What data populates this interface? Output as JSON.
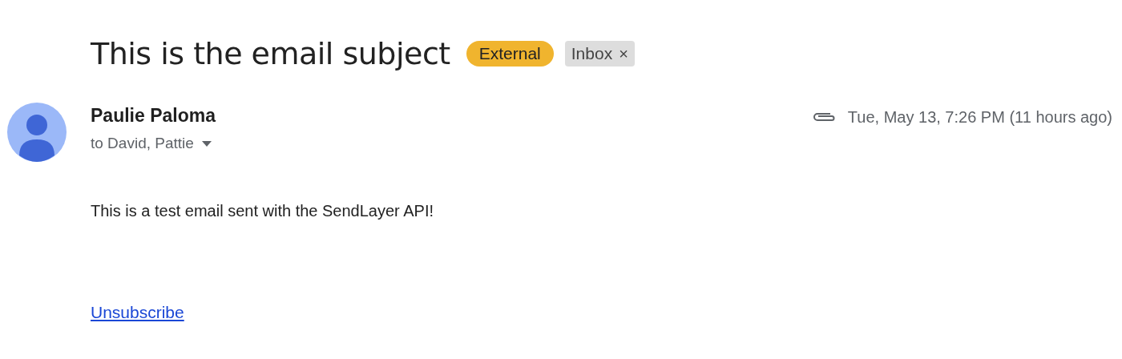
{
  "subject": "This is the email subject",
  "labels": [
    {
      "text": "External",
      "color": "#f0b42e",
      "removable": false
    },
    {
      "text": "Inbox",
      "color": "#dddddd",
      "removable": true,
      "remove_glyph": "×"
    }
  ],
  "message": {
    "sender": "Paulie Paloma",
    "recipients": "to David, Pattie",
    "has_attachment": true,
    "date": "Tue, May 13, 7:26 PM (11 hours ago)",
    "body": "This is a test email sent with the SendLayer API!",
    "link": "Unsubscribe"
  }
}
